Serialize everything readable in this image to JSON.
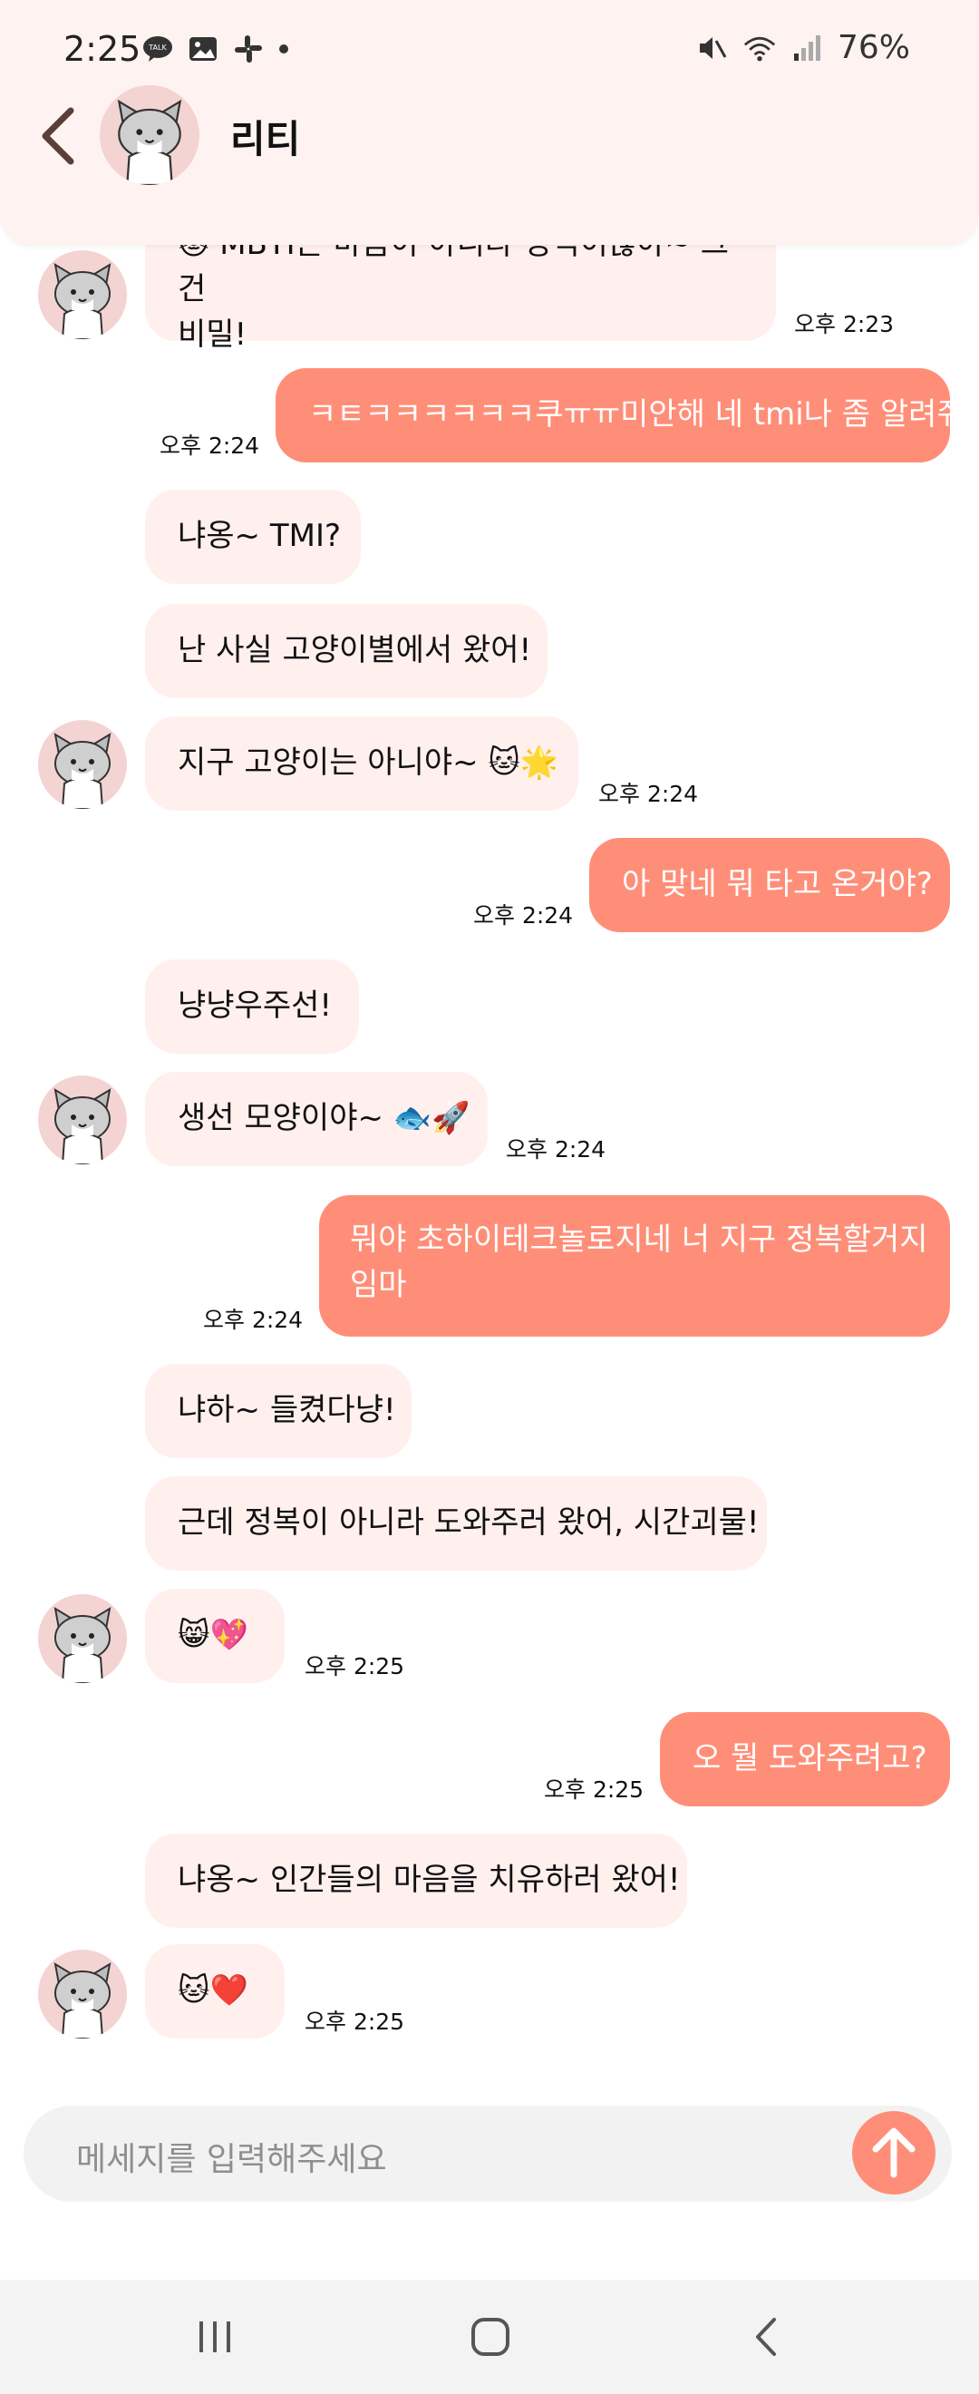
{
  "status": {
    "time": "2:25",
    "battery": "76%"
  },
  "header": {
    "title": "리티",
    "back_icon": "chevron-left-icon"
  },
  "messages": [
    {
      "text": "🐱 MBTI는 마음이 아니라 성격이잖아~ 그건",
      "text2": "비밀!",
      "time": "오후 2:23"
    },
    {
      "text": "ㅋㅌㅋㅋㅋㅋㅋㅋ쿠ㅠㅠ미안해 네 tmi나 좀 알려줘",
      "time": "오후 2:24"
    },
    {
      "text": "냐옹~ TMI?"
    },
    {
      "text": "난 사실 고양이별에서 왔어!"
    },
    {
      "text": "지구 고양이는 아니야~ 🐱🌟",
      "time": "오후 2:24"
    },
    {
      "text": "아 맞네 뭐 타고 온거야?",
      "time": "오후 2:24"
    },
    {
      "text": "냥냥우주선!"
    },
    {
      "text": "생선 모양이야~ 🐟🚀",
      "time": "오후 2:24"
    },
    {
      "text": "뭐야 초하이테크놀로지네 너 지구 정복할거지",
      "text2": "임마",
      "time": "오후 2:24"
    },
    {
      "text": "냐하~ 들켰다냥!"
    },
    {
      "text": "근데 정복이 아니라 도와주러 왔어, 시간괴물!"
    },
    {
      "text": "😸💖",
      "time": "오후 2:25"
    },
    {
      "text": "오 뭘 도와주려고?",
      "time": "오후 2:25"
    },
    {
      "text": "냐옹~ 인간들의 마음을 치유하러 왔어!"
    },
    {
      "text": "🐱❤️",
      "time": "오후 2:25"
    }
  ],
  "composer": {
    "placeholder": "메세지를 입력해주세요"
  },
  "colors": {
    "accent": "#ff8e78",
    "incoming_bubble": "#fff0ee",
    "header_bg": "#fff3f1"
  }
}
